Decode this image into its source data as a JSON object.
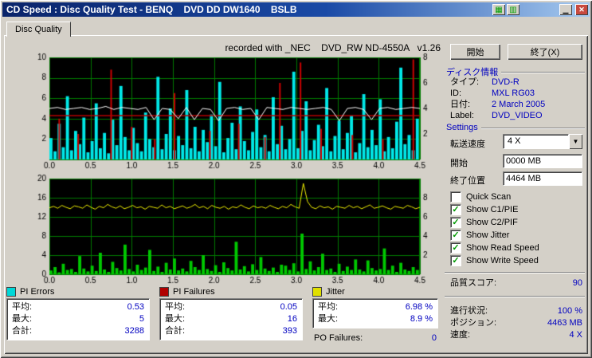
{
  "window": {
    "title": "CD Speed : Disc Quality Test - BENQ    DVD DD DW1640    BSLB"
  },
  "tab": {
    "label": "Disc Quality"
  },
  "chart_header": "recorded with _NEC    DVD_RW ND-4550A   v1.26",
  "buttons": {
    "start": "開始",
    "exit": "終了(X)"
  },
  "disc_info": {
    "title": "ディスク情報",
    "rows": [
      {
        "label": "タイプ:",
        "value": "DVD-R"
      },
      {
        "label": "ID:",
        "value": "MXL RG03"
      },
      {
        "label": "日付:",
        "value": "2 March 2005"
      },
      {
        "label": "Label:",
        "value": "DVD_VIDEO"
      }
    ]
  },
  "settings": {
    "title": "Settings",
    "speed_label": "転送速度",
    "speed_value": "4 X",
    "start_label": "開始",
    "start_value": "0000 MB",
    "end_label": "終了位置",
    "end_value": "4464 MB",
    "checkboxes": [
      {
        "label": "Quick Scan",
        "checked": false
      },
      {
        "label": "Show C1/PIE",
        "checked": true
      },
      {
        "label": "Show C2/PIF",
        "checked": true
      },
      {
        "label": "Show Jitter",
        "checked": true
      },
      {
        "label": "Show Read Speed",
        "checked": true
      },
      {
        "label": "Show Write Speed",
        "checked": true
      }
    ]
  },
  "quality": {
    "label": "品質スコア:",
    "value": "90"
  },
  "status": {
    "rows": [
      {
        "label": "進行状況:",
        "value": "100 %"
      },
      {
        "label": "ポジション:",
        "value": "4463 MB"
      },
      {
        "label": "速度:",
        "value": "4 X"
      }
    ]
  },
  "stats": [
    {
      "id": "pi-errors",
      "title": "PI Errors",
      "color": "#00d8d8",
      "rows": [
        [
          "平均:",
          "0.53"
        ],
        [
          "最大:",
          "5"
        ],
        [
          "合計:",
          "3288"
        ]
      ]
    },
    {
      "id": "pi-failures",
      "title": "PI Failures",
      "color": "#b00000",
      "rows": [
        [
          "平均:",
          "0.05"
        ],
        [
          "最大:",
          "16"
        ],
        [
          "合計:",
          "393"
        ]
      ]
    },
    {
      "id": "jitter",
      "title": "Jitter",
      "color": "#e0e000",
      "rows": [
        [
          "平均:",
          "6.98 %"
        ],
        [
          "最大:",
          "8.9 %"
        ]
      ],
      "extra": {
        "label": "PO Failures:",
        "value": "0"
      }
    }
  ],
  "chart_data": [
    {
      "type": "bar",
      "name": "pi-errors-chart",
      "bg": "#000000",
      "grid": "#007a00",
      "x_range": [
        0,
        4.5
      ],
      "x_ticks": [
        "0.0",
        "0.5",
        "1.0",
        "1.5",
        "2.0",
        "2.5",
        "3.0",
        "3.5",
        "4.0",
        "4.5"
      ],
      "y_left": {
        "min": 0,
        "max": 10,
        "ticks": [
          10,
          8,
          6,
          4,
          2
        ]
      },
      "y_right": {
        "min": 0,
        "max": 8,
        "ticks": [
          8,
          6,
          4,
          2
        ]
      },
      "series": [
        {
          "name": "c1-pie-errors",
          "type": "bar",
          "color": "#00e8e8",
          "values": [
            2.1,
            0.8,
            3.5,
            1.2,
            6.2,
            0.9,
            2.8,
            1.5,
            4.1,
            0.7,
            1.8,
            5.5,
            1.1,
            2.6,
            0.6,
            3.9,
            1.4,
            7.2,
            2.2,
            0.9,
            3.1,
            1.6,
            0.8,
            4.6,
            2.0,
            1.2,
            8.1,
            1.0,
            2.5,
            5.0,
            0.9,
            2.3,
            1.4,
            6.8,
            1.1,
            3.2,
            0.8,
            2.9,
            1.7,
            4.4,
            1.3,
            7.6,
            0.7,
            2.1,
            3.6,
            1.0,
            5.2,
            1.8,
            0.9,
            2.7,
            4.9,
            1.2,
            2.4,
            0.8,
            6.1,
            1.5,
            3.3,
            1.0,
            2.0,
            8.6,
            1.1,
            2.8,
            5.7,
            0.9,
            1.9,
            3.4,
            1.3,
            7.0,
            0.8,
            2.3,
            3.8,
            1.0,
            2.6,
            4.3,
            0.7,
            1.6,
            6.4,
            1.2,
            2.9,
            1.4,
            5.9,
            0.8,
            2.2,
            1.1,
            3.7,
            9.0,
            1.5,
            2.4,
            0.9,
            4.0
          ]
        },
        {
          "name": "c2-pif-spikes",
          "type": "vlines",
          "color": "#cc0000",
          "points": [
            [
              0.12,
              4.0
            ],
            [
              0.35,
              2.5
            ],
            [
              0.75,
              8.8
            ],
            [
              1.0,
              3.2
            ],
            [
              1.28,
              2.0
            ],
            [
              1.52,
              6.5
            ],
            [
              1.95,
              2.8
            ],
            [
              2.3,
              3.5
            ],
            [
              2.62,
              2.2
            ],
            [
              2.8,
              7.5
            ],
            [
              3.05,
              9.5
            ],
            [
              3.3,
              3.0
            ],
            [
              3.68,
              2.4
            ],
            [
              4.05,
              2.0
            ],
            [
              4.42,
              9.8
            ]
          ]
        },
        {
          "name": "write-speed-line",
          "type": "hline",
          "color": "#b40000",
          "value": 4.3
        },
        {
          "name": "read-speed-line",
          "type": "line",
          "color": "#ffffff",
          "values": [
            5.0,
            5.1,
            4.9,
            5.0,
            5.1,
            4.9,
            5.0,
            5.2,
            4.9,
            5.1,
            5.0,
            4.9,
            5.1,
            3.9,
            5.0,
            4.9,
            4.0,
            5.1,
            3.9,
            5.0,
            4.9,
            3.8,
            5.0,
            5.1,
            4.9,
            5.0,
            3.9,
            5.1,
            5.0,
            4.9,
            5.1,
            5.0,
            4.9,
            5.0,
            5.1,
            4.9,
            3.8,
            5.0,
            5.1,
            4.9,
            3.9,
            5.0,
            5.1,
            4.9,
            5.0,
            5.1,
            5.0
          ]
        }
      ]
    },
    {
      "type": "bar",
      "name": "pi-failures-jitter-chart",
      "bg": "#000000",
      "grid": "#007a00",
      "x_range": [
        0,
        4.5
      ],
      "x_ticks": [
        "0.0",
        "0.5",
        "1.0",
        "1.5",
        "2.0",
        "2.5",
        "3.0",
        "3.5",
        "4.0",
        "4.5"
      ],
      "y_left": {
        "min": 0,
        "max": 20,
        "ticks": [
          20,
          16,
          12,
          8,
          4,
          0
        ]
      },
      "y_right": {
        "min": 0,
        "max": 10,
        "ticks": [
          8,
          6,
          4,
          2
        ]
      },
      "series": [
        {
          "name": "pi-failures",
          "type": "bar",
          "color": "#00c800",
          "values": [
            0.8,
            1.5,
            0.4,
            2.2,
            0.9,
            1.1,
            0.5,
            3.8,
            1.2,
            0.6,
            1.8,
            0.7,
            4.5,
            1.0,
            0.5,
            2.6,
            1.3,
            0.8,
            6.2,
            1.1,
            0.6,
            2.0,
            0.9,
            1.4,
            5.1,
            0.7,
            1.6,
            0.5,
            2.4,
            1.0,
            3.3,
            0.8,
            1.2,
            0.6,
            2.8,
            1.5,
            0.9,
            4.0,
            1.1,
            0.7,
            1.9,
            0.5,
            2.5,
            1.3,
            0.8,
            6.8,
            1.0,
            1.7,
            0.6,
            2.1,
            0.9,
            3.6,
            1.2,
            0.7,
            1.4,
            0.5,
            2.0,
            1.8,
            0.9,
            2.3,
            0.6,
            8.5,
            1.1,
            2.7,
            0.8,
            1.5,
            4.3,
            0.9,
            1.2,
            0.5,
            2.2,
            0.7,
            1.6,
            0.9,
            3.1,
            1.0,
            0.6,
            2.9,
            1.3,
            0.8,
            1.1,
            5.4,
            0.9,
            1.8,
            0.5,
            2.4,
            1.0,
            0.7,
            1.5,
            0.9
          ]
        },
        {
          "name": "jitter",
          "type": "line",
          "color": "#f0f000",
          "values": [
            13.9,
            14.2,
            13.8,
            14.4,
            14.0,
            13.7,
            14.3,
            14.1,
            13.8,
            14.5,
            14.0,
            13.6,
            14.2,
            13.9,
            14.6,
            14.1,
            13.8,
            14.3,
            13.7,
            14.0,
            14.4,
            13.9,
            14.1,
            13.6,
            14.2,
            14.0,
            13.8,
            14.5,
            13.9,
            14.2,
            13.7,
            14.0,
            14.3,
            13.8,
            14.1,
            14.6,
            13.9,
            14.2,
            13.7,
            14.4,
            14.0,
            13.8,
            14.2,
            13.6,
            14.1,
            13.9,
            14.5,
            14.0,
            13.7,
            14.3,
            13.9,
            14.1,
            13.8,
            14.4,
            14.0,
            13.7,
            14.2,
            13.9,
            14.6,
            14.1,
            13.8,
            19.0,
            15.2,
            14.0,
            13.7,
            14.3,
            13.9,
            14.1,
            13.6,
            14.2,
            14.0,
            13.8,
            14.4,
            13.9,
            14.2,
            13.7,
            14.1,
            14.5,
            13.8,
            14.0,
            14.3,
            13.9,
            13.6,
            14.2,
            14.0,
            13.8,
            14.4,
            14.1,
            13.7,
            14.0
          ]
        }
      ]
    }
  ]
}
